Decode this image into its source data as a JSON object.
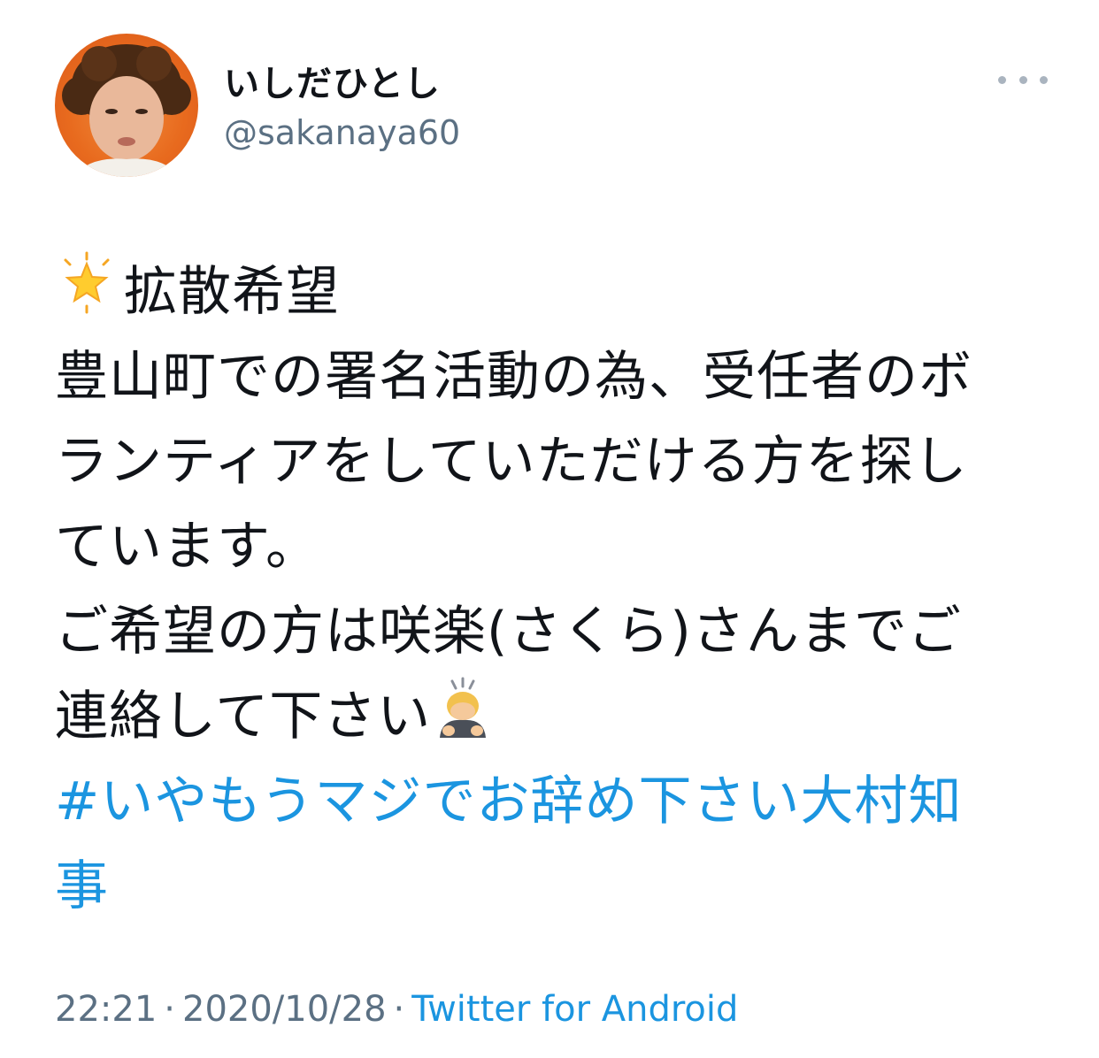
{
  "user": {
    "display_name": "いしだひとし",
    "handle": "@sakanaya60",
    "avatar_icon": "profile-photo"
  },
  "more_icon": "more-horizontal-icon",
  "tweet": {
    "lines": [
      "拡散希望",
      "豊山町での署名活動の為、受任者のボ",
      "ランティアをしていただける方を探し",
      "ています。",
      "ご希望の方は咲楽(さくら)さんまでご",
      "連絡して下さい"
    ],
    "hashtag_lines": [
      "#いやもうマジでお辞め下さい大村知",
      "事"
    ],
    "leading_emoji": "glowing-star-icon",
    "trailing_emoji": "person-bowing-icon"
  },
  "meta": {
    "time": "22:21",
    "separator": "·",
    "date": "2020/10/28",
    "source": "Twitter for Android"
  },
  "colors": {
    "link": "#1b95e0",
    "secondary_text": "#5b7083",
    "primary_text": "#111419"
  }
}
